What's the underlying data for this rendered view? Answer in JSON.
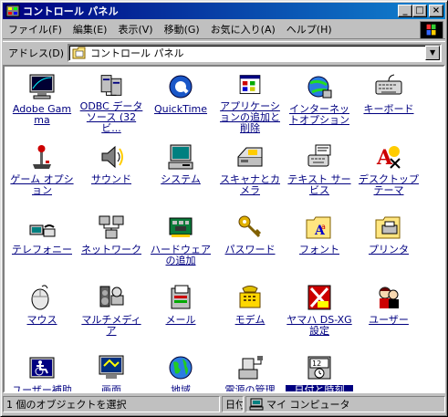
{
  "window": {
    "title": "コントロール パネル",
    "minimize_glyph": "_",
    "maximize_glyph": "□",
    "close_glyph": "×"
  },
  "menu": [
    {
      "label": "ファイル(F)"
    },
    {
      "label": "編集(E)"
    },
    {
      "label": "表示(V)"
    },
    {
      "label": "移動(G)"
    },
    {
      "label": "お気に入り(A)"
    },
    {
      "label": "ヘルプ(H)"
    }
  ],
  "address": {
    "label": "アドレス(D)",
    "value": "コントロール パネル"
  },
  "items": [
    {
      "label": "Adobe Gamma",
      "icon": "monitor-gamma-icon"
    },
    {
      "label": "ODBC データソース (32ビ...",
      "icon": "odbc-icon"
    },
    {
      "label": "QuickTime",
      "icon": "quicktime-icon"
    },
    {
      "label": "アプリケーションの追加と削除",
      "icon": "add-remove-programs-icon"
    },
    {
      "label": "インターネットオプション",
      "icon": "internet-options-icon"
    },
    {
      "label": "キーボード",
      "icon": "keyboard-icon"
    },
    {
      "label": "ゲーム オプション",
      "icon": "joystick-icon"
    },
    {
      "label": "サウンド",
      "icon": "speaker-icon"
    },
    {
      "label": "システム",
      "icon": "computer-icon"
    },
    {
      "label": "スキャナとカメラ",
      "icon": "scanner-icon"
    },
    {
      "label": "テキスト サービス",
      "icon": "text-services-icon"
    },
    {
      "label": "デスクトップ テーマ",
      "icon": "desktop-theme-icon"
    },
    {
      "label": "テレフォニー",
      "icon": "telephony-icon"
    },
    {
      "label": "ネットワーク",
      "icon": "network-icon"
    },
    {
      "label": "ハードウェアの追加",
      "icon": "add-hardware-icon"
    },
    {
      "label": "パスワード",
      "icon": "keys-icon"
    },
    {
      "label": "フォント",
      "icon": "fonts-folder-icon"
    },
    {
      "label": "プリンタ",
      "icon": "printers-folder-icon"
    },
    {
      "label": "マウス",
      "icon": "mouse-icon"
    },
    {
      "label": "マルチメディア",
      "icon": "multimedia-icon"
    },
    {
      "label": "メール",
      "icon": "mail-icon"
    },
    {
      "label": "モデム",
      "icon": "modem-icon"
    },
    {
      "label": "ヤマハ DS-XG 設定",
      "icon": "yamaha-icon"
    },
    {
      "label": "ユーザー",
      "icon": "users-icon"
    },
    {
      "label": "ユーザー補助",
      "icon": "accessibility-icon"
    },
    {
      "label": "画面",
      "icon": "display-icon"
    },
    {
      "label": "地域",
      "icon": "globe-icon"
    },
    {
      "label": "電源の管理",
      "icon": "power-icon"
    },
    {
      "label": "日付と時刻",
      "icon": "date-time-icon",
      "selected": true
    }
  ],
  "status": {
    "left": "1 個のオブジェクトを選択",
    "mid": "日付",
    "right": "マイ コンピュータ"
  },
  "colors": {
    "titlebar_start": "#000080",
    "titlebar_end": "#1084d0",
    "link": "#000080",
    "selection": "#000080"
  }
}
